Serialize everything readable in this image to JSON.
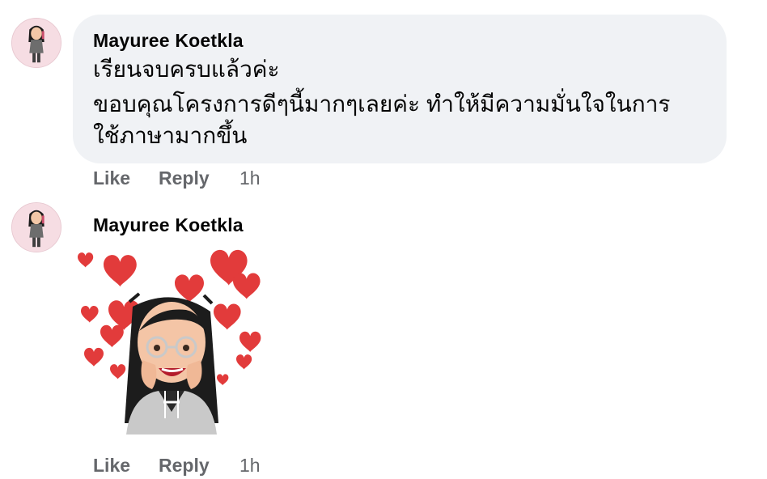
{
  "comments": [
    {
      "author": "Mayuree Koetkla",
      "lines": [
        "เรียนจบครบแล้วค่ะ",
        "ขอบคุณโครงการดีๆนี้มากๆเลยค่ะ ทำให้มีความมั่นใจในการ",
        "ใช้ภาษามากขึ้น"
      ],
      "like_label": "Like",
      "reply_label": "Reply",
      "time": "1h"
    },
    {
      "author": "Mayuree Koetkla",
      "sticker": "avatar-hearts-sticker",
      "like_label": "Like",
      "reply_label": "Reply",
      "time": "1h"
    }
  ],
  "colors": {
    "bubble_bg": "#f0f2f5",
    "secondary_text": "#65676b",
    "heart": "#e23b3b",
    "avatar_bg": "#f6dde3"
  }
}
